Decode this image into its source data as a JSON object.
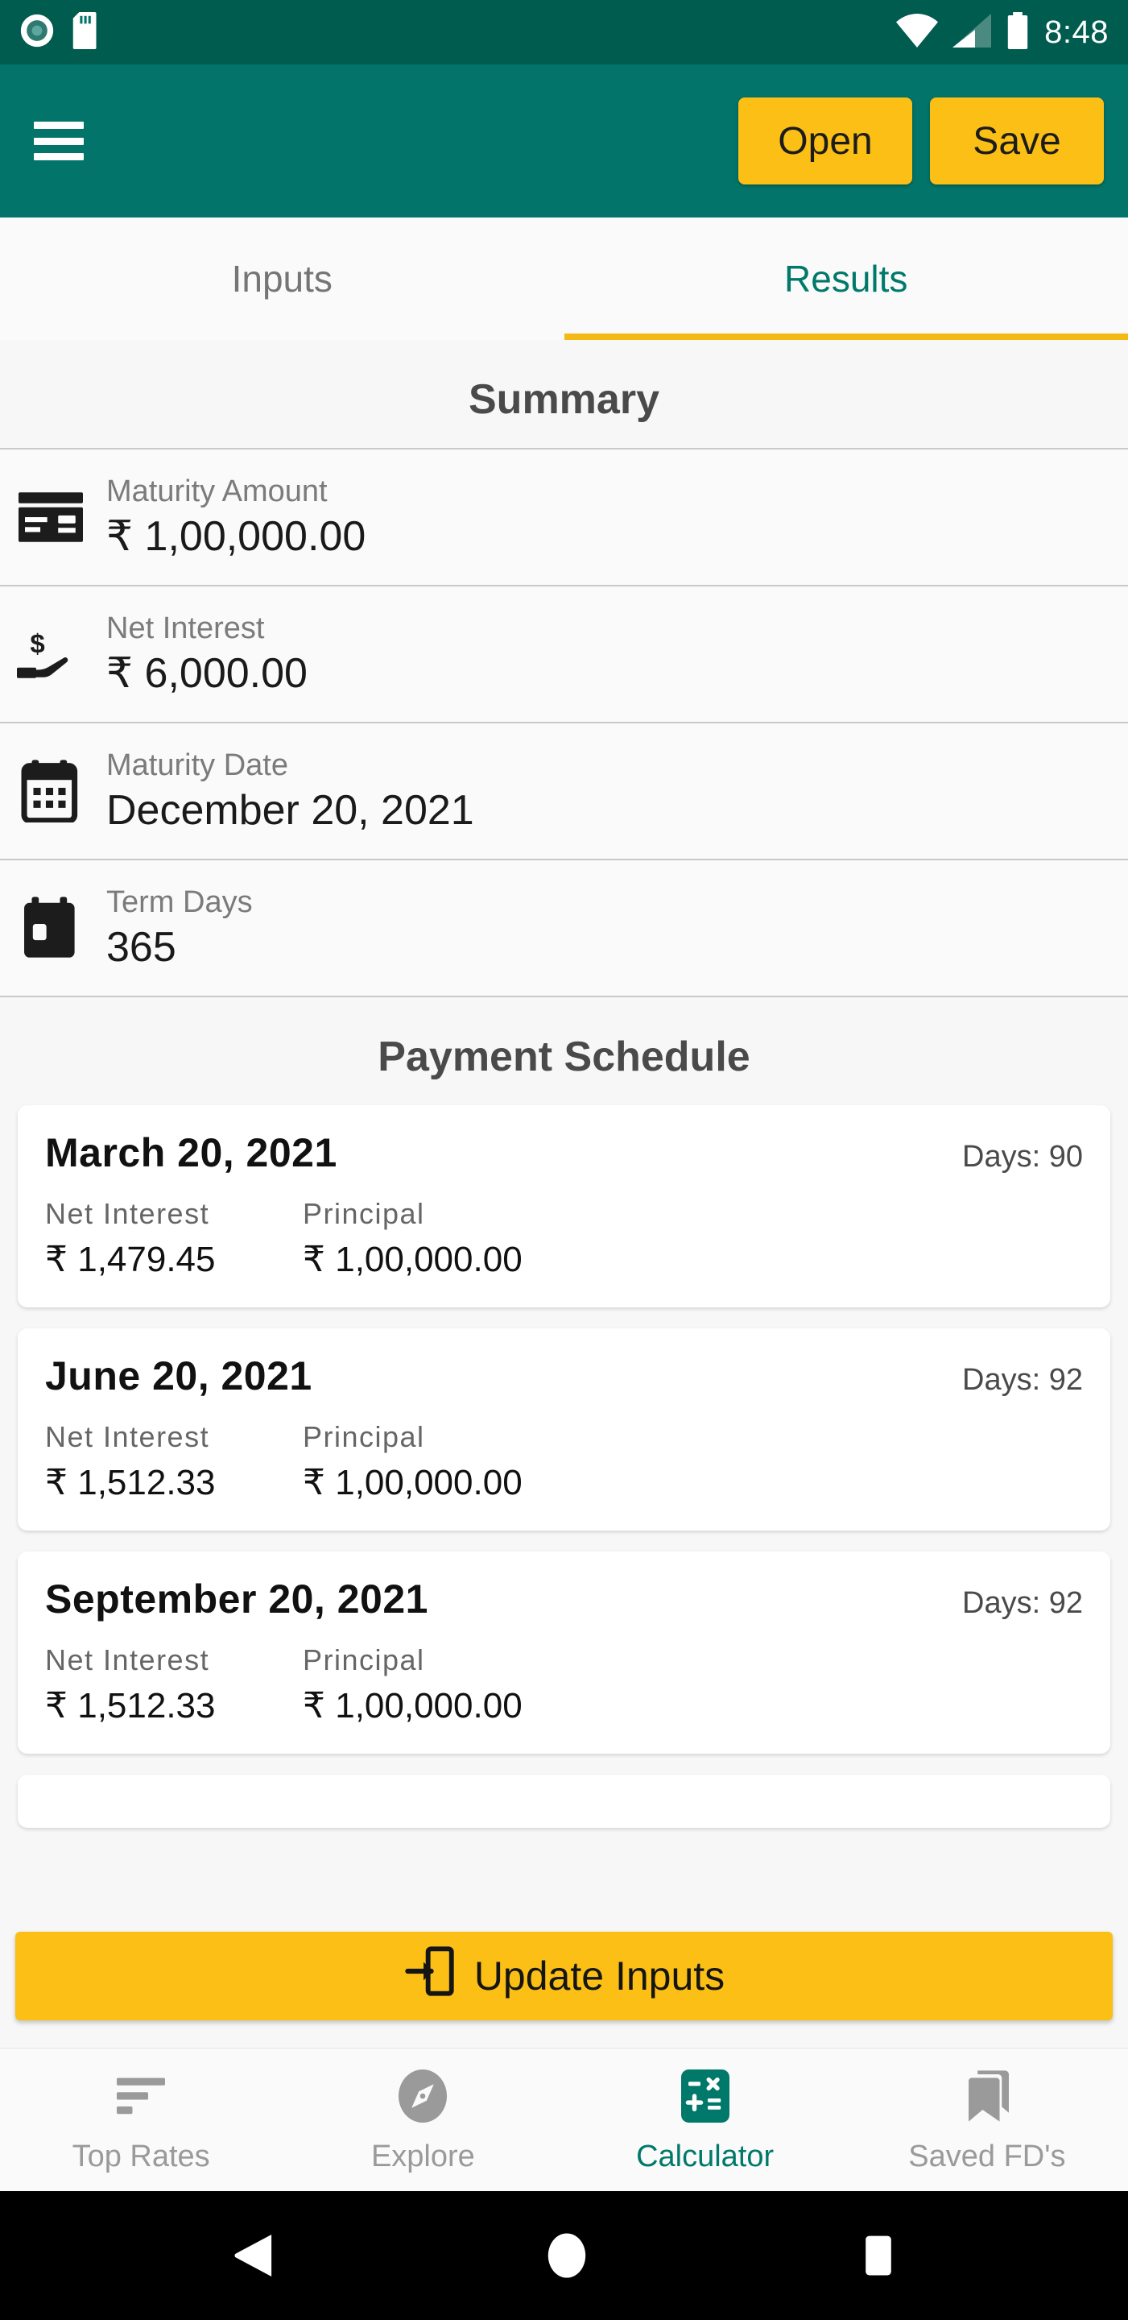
{
  "statusbar": {
    "time": "8:48",
    "icons": [
      "record-icon",
      "sd-card-icon",
      "wifi-icon",
      "cellular-signal-icon",
      "battery-icon"
    ]
  },
  "appbar": {
    "menu_icon": "hamburger-menu-icon",
    "open_label": "Open",
    "save_label": "Save",
    "background_color": "#027469",
    "button_color": "#FBBF15"
  },
  "tabs": {
    "items": [
      {
        "label": "Inputs",
        "active": false
      },
      {
        "label": "Results",
        "active": true
      }
    ],
    "active_color": "#00796b",
    "indicator_color": "#F5B916"
  },
  "summary": {
    "title": "Summary",
    "rows": [
      {
        "icon": "credit-card-icon",
        "label": "Maturity Amount",
        "value": "₹ 1,00,000.00"
      },
      {
        "icon": "hand-holding-dollar-icon",
        "label": "Net Interest",
        "value": "₹ 6,000.00"
      },
      {
        "icon": "calendar-icon",
        "label": "Maturity Date",
        "value": "December 20, 2021"
      },
      {
        "icon": "calendar-day-icon",
        "label": "Term Days",
        "value": "365"
      }
    ]
  },
  "schedule": {
    "title": "Payment Schedule",
    "col_label_interest": "Net Interest",
    "col_label_principal": "Principal",
    "days_prefix": "Days: ",
    "cards": [
      {
        "date": "March 20, 2021",
        "days": "Days: 90",
        "net_interest": "₹ 1,479.45",
        "principal": "₹ 1,00,000.00"
      },
      {
        "date": "June 20, 2021",
        "days": "Days: 92",
        "net_interest": "₹ 1,512.33",
        "principal": "₹ 1,00,000.00"
      },
      {
        "date": "September 20, 2021",
        "days": "Days: 92",
        "net_interest": "₹ 1,512.33",
        "principal": "₹ 1,00,000.00"
      }
    ]
  },
  "update_button": {
    "label": "Update Inputs",
    "icon": "login-arrow-icon",
    "color": "#FBBF15"
  },
  "bottomnav": {
    "items": [
      {
        "label": "Top Rates",
        "icon": "sort-list-icon",
        "active": false
      },
      {
        "label": "Explore",
        "icon": "compass-icon",
        "active": false
      },
      {
        "label": "Calculator",
        "icon": "calculator-icon",
        "active": true
      },
      {
        "label": "Saved FD's",
        "icon": "bookmark-icon",
        "active": false
      }
    ],
    "active_color": "#00796b",
    "inactive_color": "#9a9a9a"
  },
  "androidnav": {
    "back": "back-triangle-icon",
    "home": "home-circle-icon",
    "recents": "recents-square-icon"
  }
}
